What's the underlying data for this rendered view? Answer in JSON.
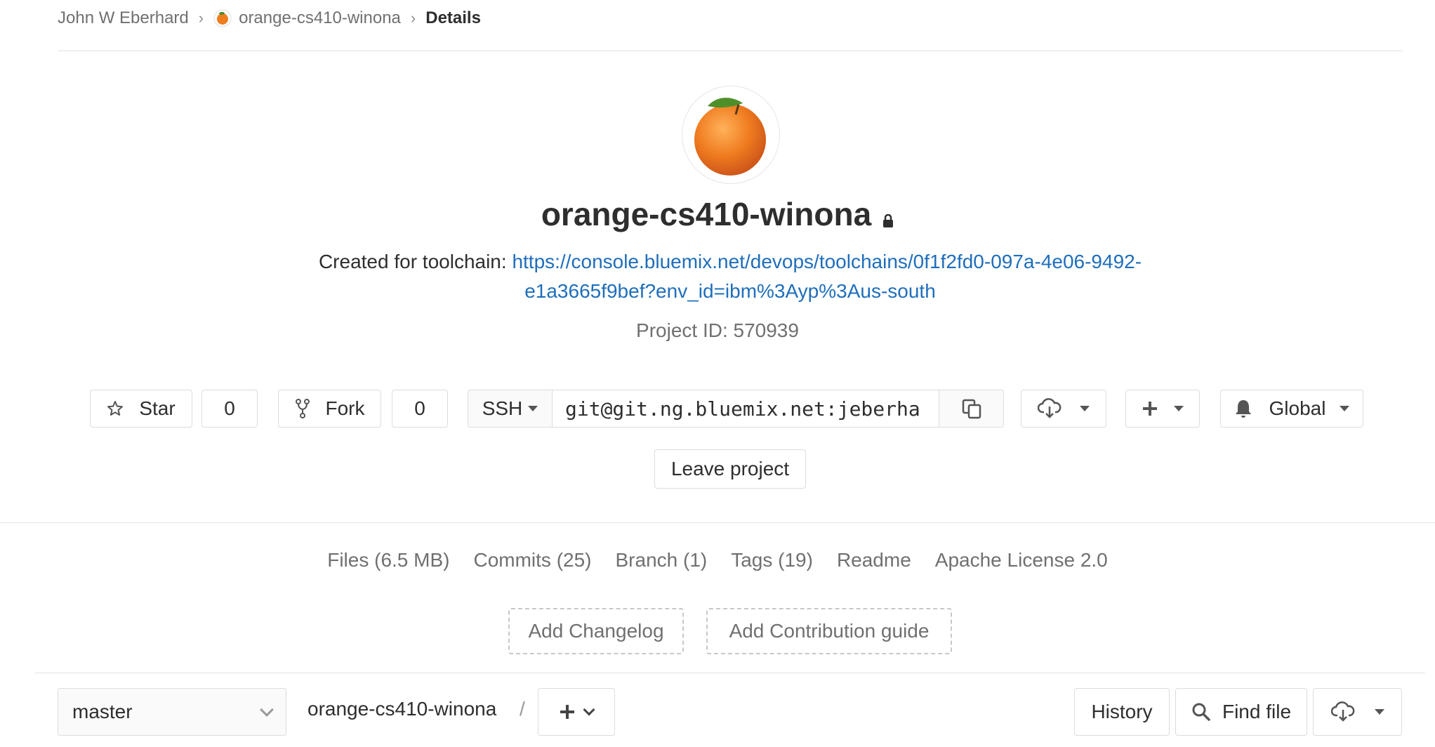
{
  "breadcrumb": {
    "owner": "John W Eberhard",
    "project": "orange-cs410-winona",
    "current": "Details"
  },
  "project": {
    "name": "orange-cs410-winona",
    "description_prefix": "Created for toolchain: ",
    "description_link_line1": "https://console.bluemix.net/devops/toolchains/0f1f2fd0-097a-4e06-9492-",
    "description_link_line2": "e1a3665f9bef?env_id=ibm%3Ayp%3Aus-south",
    "id_text": "Project ID: 570939",
    "visibility": "private",
    "avatar": "orange-icon"
  },
  "actions": {
    "star_label": "Star",
    "star_count": "0",
    "fork_label": "Fork",
    "fork_count": "0",
    "clone_protocol": "SSH",
    "clone_url": "git@git.ng.bluemix.net:jeberha",
    "notification_level": "Global",
    "leave_label": "Leave project"
  },
  "stats": {
    "files": "Files (6.5 MB)",
    "commits": "Commits (25)",
    "branch": "Branch (1)",
    "tags": "Tags (19)",
    "readme": "Readme",
    "license": "Apache License 2.0"
  },
  "suggestions": {
    "changelog": "Add Changelog",
    "contribution": "Add Contribution guide"
  },
  "tree": {
    "branch": "master",
    "root": "orange-cs410-winona",
    "separator": "/",
    "history_label": "History",
    "find_file_label": "Find file"
  },
  "colors": {
    "link": "#1f6ebb",
    "orange": "#ef7d1f",
    "leaf": "#4a8a2a"
  }
}
